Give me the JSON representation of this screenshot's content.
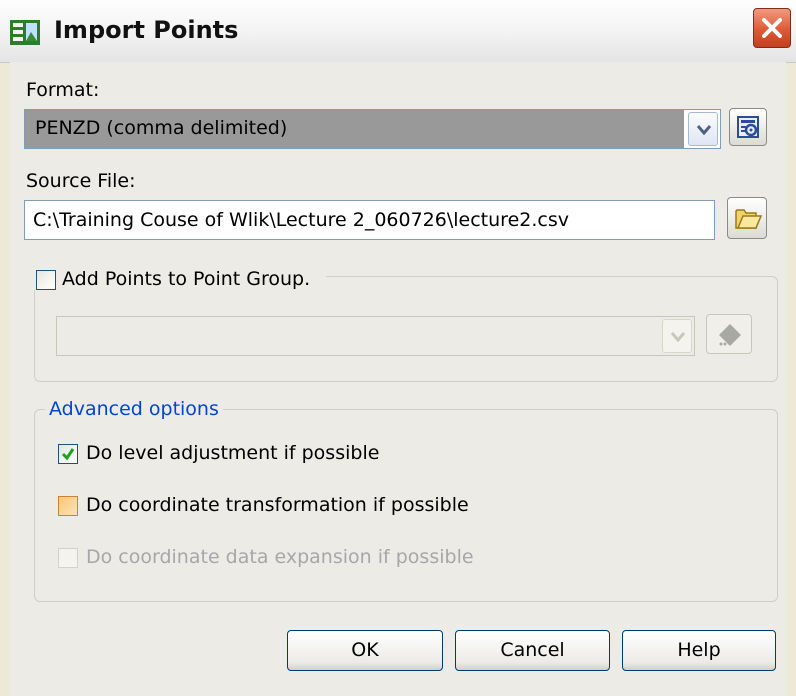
{
  "window": {
    "title": "Import Points",
    "icon": "import-points-app-icon"
  },
  "format": {
    "label": "Format:",
    "value": "PENZD (comma delimited)",
    "manage_icon": "manage-formats-icon"
  },
  "source_file": {
    "label": "Source File:",
    "value": "C:\\Training Couse of Wlik\\Lecture 2_060726\\lecture2.csv",
    "browse_icon": "folder-open-icon"
  },
  "point_group": {
    "label": "Add Points to Point Group.",
    "checked": false,
    "value": "",
    "create_icon": "create-point-group-icon"
  },
  "advanced": {
    "legend": "Advanced options",
    "options": [
      {
        "label": "Do level adjustment if possible",
        "checked": true,
        "enabled": true
      },
      {
        "label": "Do coordinate transformation if possible",
        "checked": false,
        "enabled": true
      },
      {
        "label": "Do coordinate data expansion if possible",
        "checked": false,
        "enabled": false
      }
    ]
  },
  "buttons": {
    "ok": "OK",
    "cancel": "Cancel",
    "help": "Help"
  },
  "colors": {
    "accent_legend": "#0046d5",
    "disabled_text": "#a7a6aa",
    "checkmark": "#21a121",
    "close_button": "#dc5a36"
  }
}
